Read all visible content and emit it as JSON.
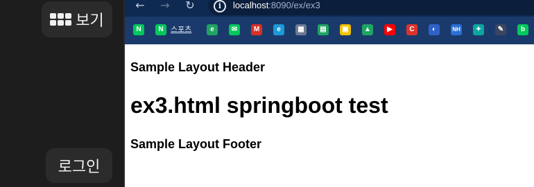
{
  "sidebar": {
    "view_label": "보기",
    "login_label": "로그인"
  },
  "browser": {
    "address": {
      "host": "localhost",
      "path": ":8090/ex/ex3"
    },
    "bookmarks": {
      "items": [
        {
          "icon": "naver-icon",
          "glyph": "N",
          "color": "#03c75a"
        },
        {
          "icon": "naver-icon",
          "glyph": "N",
          "color": "#03c75a"
        },
        {
          "icon": "green-square-icon",
          "glyph": "e",
          "color": "#1ea362"
        },
        {
          "icon": "mail-icon",
          "glyph": "✉",
          "color": "#03c75a"
        },
        {
          "icon": "gmail-icon",
          "glyph": "M",
          "color": "#d93025"
        },
        {
          "icon": "edge-icon",
          "glyph": "e",
          "color": "#1a9ad6"
        },
        {
          "icon": "calendar-icon",
          "glyph": "▦",
          "color": "#6c7a92"
        },
        {
          "icon": "sheet-icon",
          "glyph": "▤",
          "color": "#1fa463"
        },
        {
          "icon": "yellow-box-icon",
          "glyph": "▣",
          "color": "#f2c200"
        },
        {
          "icon": "drive-icon",
          "glyph": "▲",
          "color": "#1fa463"
        },
        {
          "icon": "youtube-icon",
          "glyph": "▶",
          "color": "#ff0000"
        },
        {
          "icon": "c-icon",
          "glyph": "C",
          "color": "#d9342b"
        },
        {
          "icon": "world-icon",
          "glyph": "◐",
          "color": "#2f62c9"
        },
        {
          "icon": "nh-icon",
          "glyph": "NH",
          "color": "#2a6fd6"
        },
        {
          "icon": "figure-icon",
          "glyph": "✦",
          "color": "#0aa6a0"
        },
        {
          "icon": "pen-icon",
          "glyph": "✎",
          "color": "#3a4660"
        },
        {
          "icon": "blog-icon",
          "glyph": "b",
          "color": "#03c75a"
        }
      ],
      "label": "스포츠"
    }
  },
  "page": {
    "header": "Sample Layout Header",
    "title": "ex3.html springboot test",
    "footer": "Sample Layout Footer"
  }
}
